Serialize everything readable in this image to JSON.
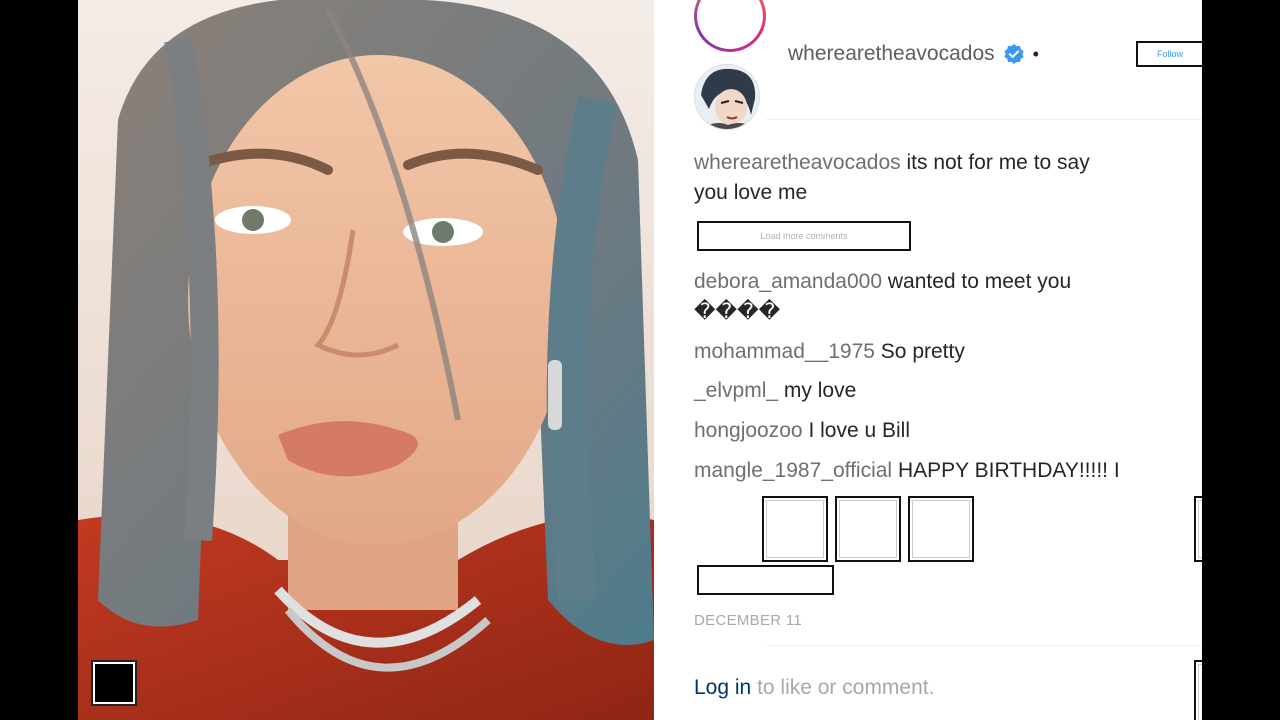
{
  "post": {
    "username": "wherearetheavocados",
    "separator": "•",
    "follow_label": "Follow",
    "caption": {
      "author": "wherearetheavocados",
      "text": "its not for me to say you love me"
    },
    "load_more_label": "Load more comments",
    "comments": [
      {
        "author": "debora_amanda000",
        "text": "wanted to meet you ����"
      },
      {
        "author": "mohammad__1975",
        "text": "So pretty"
      },
      {
        "author": "_elvpml_",
        "text": "my love"
      },
      {
        "author": "hongjoozoo",
        "text": "I love u Bill"
      },
      {
        "author": "mangle_1987_official",
        "text": "HAPPY BIRTHDAY!!!!! I"
      }
    ],
    "date": "DECEMBER 11",
    "login": {
      "link": "Log in",
      "rest": "to like or comment."
    }
  },
  "icons": {
    "verified": "verified-badge-icon",
    "accent": "#3897f0"
  }
}
